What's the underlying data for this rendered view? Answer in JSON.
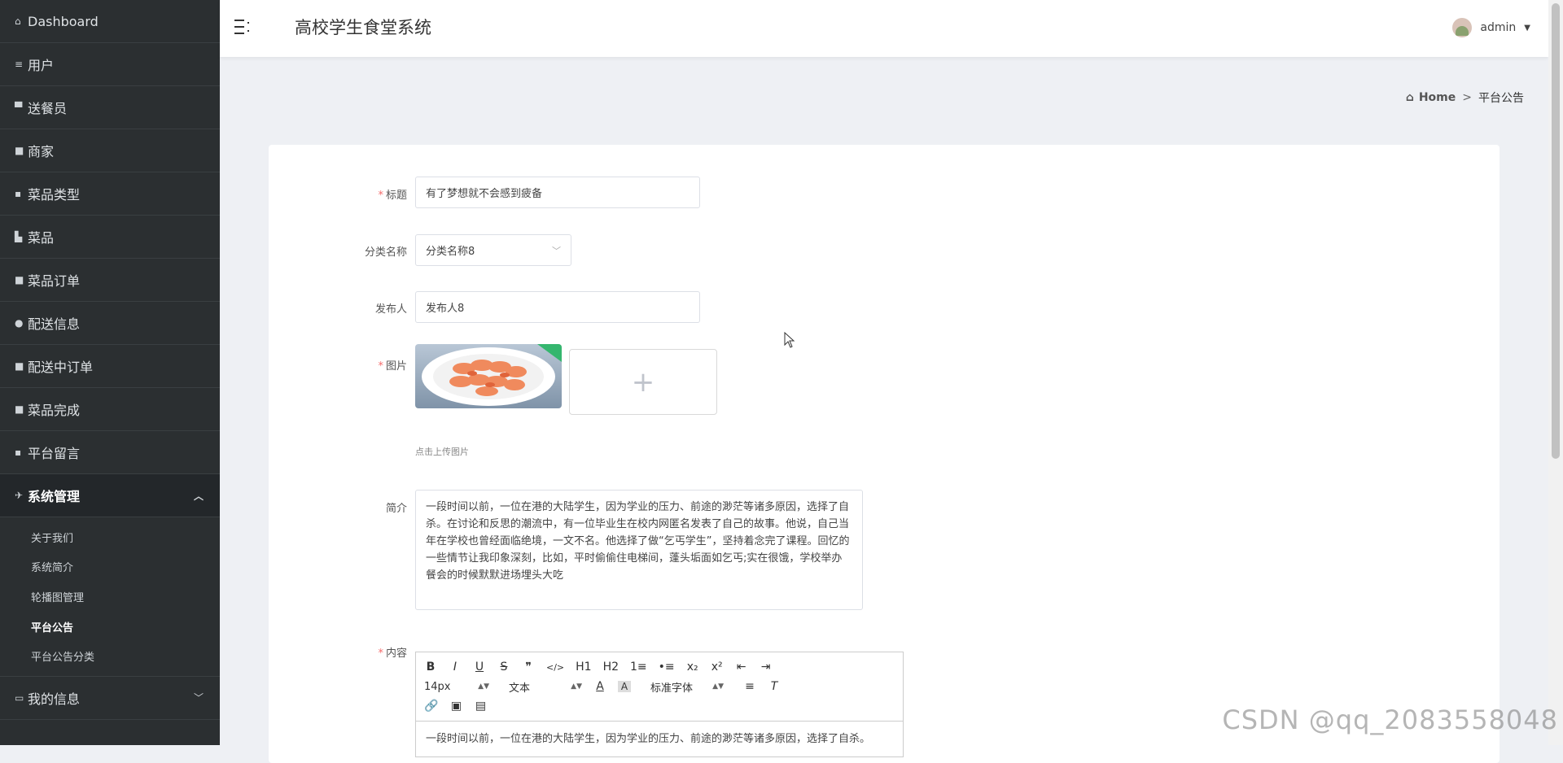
{
  "app": {
    "title": "高校学生食堂系统"
  },
  "user": {
    "name": "admin"
  },
  "sidebar": {
    "items": [
      {
        "label": "Dashboard",
        "icon": "home-icon"
      },
      {
        "label": "用户",
        "icon": "list-icon"
      },
      {
        "label": "送餐员",
        "icon": "monitor-icon"
      },
      {
        "label": "商家",
        "icon": "grid-icon"
      },
      {
        "label": "菜品类型",
        "icon": "clipboard-icon"
      },
      {
        "label": "菜品",
        "icon": "bar-chart-icon"
      },
      {
        "label": "菜品订单",
        "icon": "grid-icon"
      },
      {
        "label": "配送信息",
        "icon": "map-pin-icon"
      },
      {
        "label": "配送中订单",
        "icon": "grid-icon"
      },
      {
        "label": "菜品完成",
        "icon": "grid-icon"
      },
      {
        "label": "平台留言",
        "icon": "clipboard-icon"
      },
      {
        "label": "系统管理",
        "icon": "send-icon"
      },
      {
        "label": "我的信息",
        "icon": "calendar-icon"
      }
    ],
    "submenu": [
      "关于我们",
      "系统简介",
      "轮播图管理",
      "平台公告",
      "平台公告分类"
    ]
  },
  "breadcrumb": {
    "home": "Home",
    "separator": ">",
    "current": "平台公告"
  },
  "form": {
    "title_label": "标题",
    "title_value": "有了梦想就不会感到疲备",
    "category_label": "分类名称",
    "category_value": "分类名称8",
    "publisher_label": "发布人",
    "publisher_value": "发布人8",
    "image_label": "图片",
    "upload_hint": "点击上传图片",
    "intro_label": "简介",
    "intro_text": "一段时间以前，一位在港的大陆学生，因为学业的压力、前途的渺茫等诸多原因，选择了自杀。在讨论和反思的潮流中，有一位毕业生在校内网匿名发表了自己的故事。他说，自己当年在学校也曾经面临绝境，一文不名。他选择了做“乞丐学生”，坚持着念完了课程。回忆的一些情节让我印象深刻，比如，平时偷偷住电梯间，蓬头垢面如乞丐;实在很饿，学校举办餐会的时候默默进场埋头大吃",
    "content_label": "内容",
    "content_preview": "一段时间以前，一位在港的大陆学生，因为学业的压力、前途的渺茫等诸多原因，选择了自杀。"
  },
  "editor": {
    "row1": [
      "B",
      "I",
      "U",
      "S",
      "❞",
      "</>",
      "H1",
      "H2",
      "1≡",
      "•≡",
      "x₂",
      "x²",
      "⇤",
      "⇥"
    ],
    "font_size": "14px",
    "header_select": "文本",
    "font_family": "标准字体"
  },
  "watermark": "CSDN @qq_2083558048",
  "colors": {
    "sidebar_bg": "#2b2f31",
    "required": "#f56c6c",
    "page_bg": "#eef0f4"
  }
}
